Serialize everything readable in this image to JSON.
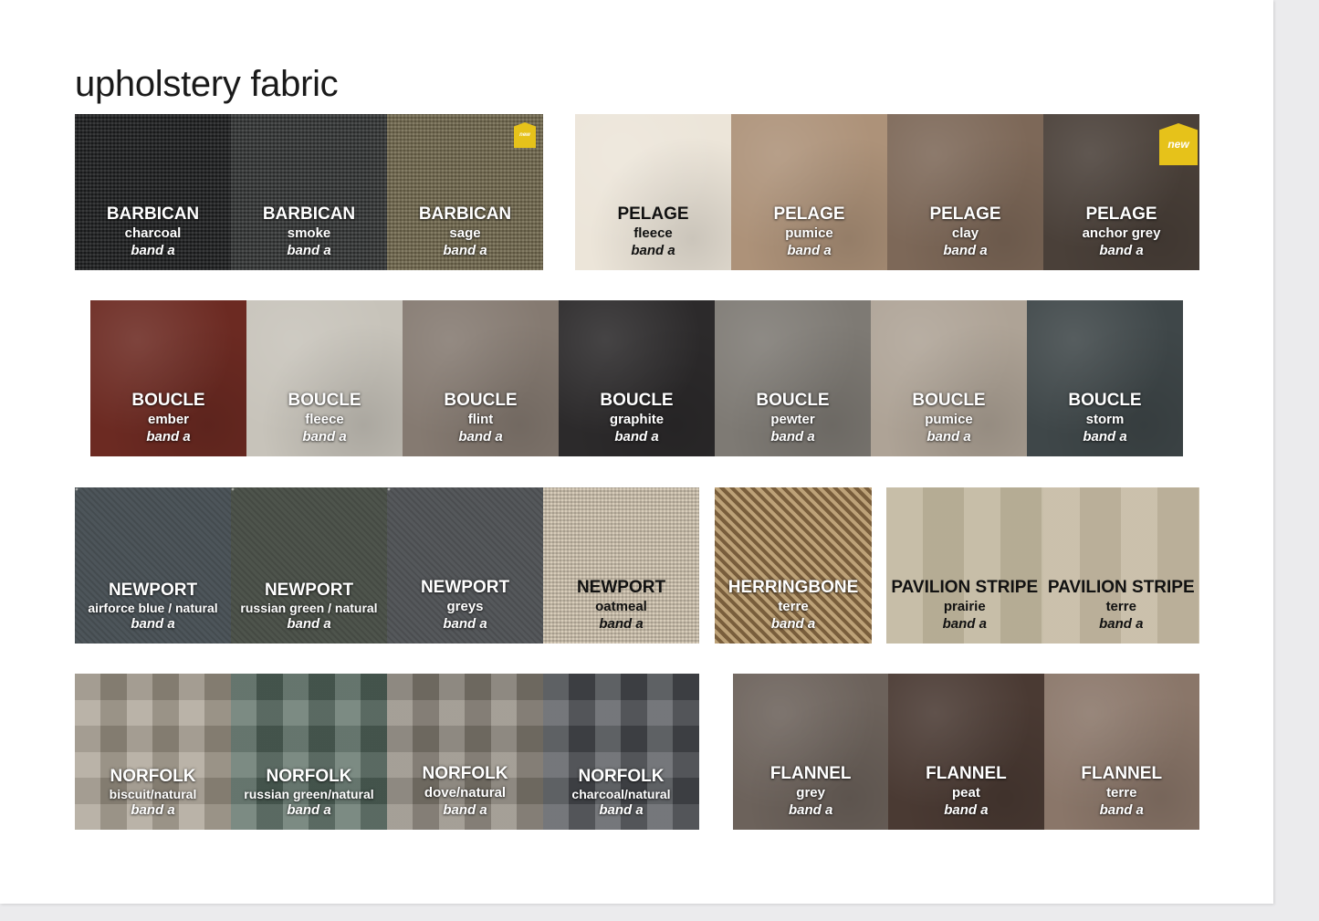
{
  "title": "upholstery fabric",
  "rows": [
    {
      "groups": [
        {
          "swatches": [
            {
              "name": "BARBICAN",
              "color": "charcoal",
              "band": "band a",
              "bg": "#1e1f20",
              "pattern": "weave"
            },
            {
              "name": "BARBICAN",
              "color": "smoke",
              "band": "band a",
              "bg": "#353737",
              "pattern": "weave"
            },
            {
              "name": "BARBICAN",
              "color": "sage",
              "band": "band a",
              "bg": "#746b50",
              "pattern": "weave",
              "badge": "new",
              "badge_size": "small"
            }
          ]
        },
        {
          "swatches": [
            {
              "name": "PELAGE",
              "color": "fleece",
              "band": "band a",
              "bg": "#ece5d9",
              "pattern": "fur",
              "text": "dark"
            },
            {
              "name": "PELAGE",
              "color": "pumice",
              "band": "band a",
              "bg": "#ad9279",
              "pattern": "fur"
            },
            {
              "name": "PELAGE",
              "color": "clay",
              "band": "band a",
              "bg": "#7d6858",
              "pattern": "fur"
            },
            {
              "name": "PELAGE",
              "color": "anchor grey",
              "band": "band a",
              "bg": "#4a4039",
              "pattern": "fur",
              "badge": "new",
              "badge_size": "big"
            }
          ]
        }
      ]
    },
    {
      "groups": [
        {
          "swatches": [
            {
              "name": "BOUCLE",
              "color": "ember",
              "band": "band a",
              "bg": "#6c2a22",
              "pattern": "fur"
            },
            {
              "name": "BOUCLE",
              "color": "fleece",
              "band": "band a",
              "bg": "#c7c3ba",
              "pattern": "fur"
            },
            {
              "name": "BOUCLE",
              "color": "flint",
              "band": "band a",
              "bg": "#857a71",
              "pattern": "fur"
            },
            {
              "name": "BOUCLE",
              "color": "graphite",
              "band": "band a",
              "bg": "#2c2a2b",
              "pattern": "fur"
            },
            {
              "name": "BOUCLE",
              "color": "pewter",
              "band": "band a",
              "bg": "#7e7a74",
              "pattern": "fur"
            },
            {
              "name": "BOUCLE",
              "color": "pumice",
              "band": "band a",
              "bg": "#aea396",
              "pattern": "fur"
            },
            {
              "name": "BOUCLE",
              "color": "storm",
              "band": "band a",
              "bg": "#3f4749",
              "pattern": "fur"
            }
          ]
        }
      ]
    },
    {
      "groups": [
        {
          "swatches": [
            {
              "name": "NEWPORT",
              "color": "airforce blue / natural",
              "band": "band a",
              "bg": "#4d555a",
              "pattern": "dots"
            },
            {
              "name": "NEWPORT",
              "color": "russian green / natural",
              "band": "band a",
              "bg": "#4e544c",
              "pattern": "dots"
            },
            {
              "name": "NEWPORT",
              "color": "greys",
              "band": "band a",
              "bg": "#55585b",
              "pattern": "dots"
            },
            {
              "name": "NEWPORT",
              "color": "oatmeal",
              "band": "band a",
              "bg": "#d2c6b1",
              "pattern": "weave",
              "text": "dark"
            }
          ]
        },
        {
          "swatches": [
            {
              "name": "HERRINGBONE",
              "color": "terre",
              "band": "band a",
              "bg": "#9a7b52",
              "pattern": "herringbone"
            }
          ]
        },
        {
          "swatches": [
            {
              "name": "PAVILION STRIPE",
              "color": "prairie",
              "band": "band a",
              "bg": "#bfb59c",
              "pattern": "stripe",
              "text": "dark"
            },
            {
              "name": "PAVILION STRIPE",
              "color": "terre",
              "band": "band a",
              "bg": "#c4b8a1",
              "pattern": "stripe",
              "text": "dark"
            }
          ]
        }
      ]
    },
    {
      "groups": [
        {
          "swatches": [
            {
              "name": "NORFOLK",
              "color": "biscuit/natural",
              "band": "band a",
              "bg": "#a69d8e",
              "pattern": "check"
            },
            {
              "name": "NORFOLK",
              "color": "russian green/natural",
              "band": "band a",
              "bg": "#55695f",
              "pattern": "check"
            },
            {
              "name": "NORFOLK",
              "color": "dove/natural",
              "band": "band a",
              "bg": "#8a8378",
              "pattern": "check"
            },
            {
              "name": "NORFOLK",
              "color": "charcoal/natural",
              "band": "band a",
              "bg": "#4c4f54",
              "pattern": "check"
            }
          ]
        },
        {
          "swatches": [
            {
              "name": "FLANNEL",
              "color": "grey",
              "band": "band a",
              "bg": "#6c625b",
              "pattern": "fur"
            },
            {
              "name": "FLANNEL",
              "color": "peat",
              "band": "band a",
              "bg": "#4a3a33",
              "pattern": "fur"
            },
            {
              "name": "FLANNEL",
              "color": "terre",
              "band": "band a",
              "bg": "#8a7669",
              "pattern": "fur"
            }
          ]
        }
      ]
    }
  ]
}
